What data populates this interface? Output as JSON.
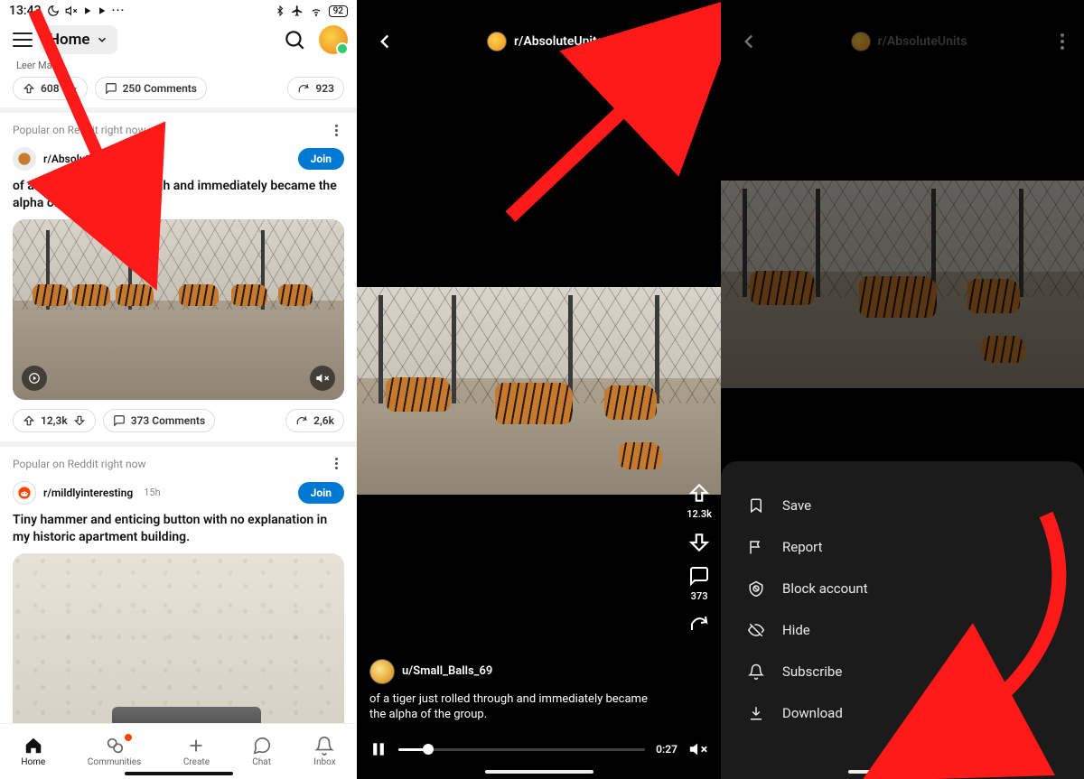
{
  "status": {
    "time": "13:43",
    "battery": "92"
  },
  "topbar": {
    "home_label": "Home"
  },
  "prev_post": {
    "leer": "Leer Más >",
    "score": "608",
    "comments": "250 Comments",
    "shares": "923"
  },
  "section_label": "Popular on Reddit right now",
  "post_tiger": {
    "subreddit": "r/AbsoluteUnits",
    "join": "Join",
    "title": "of a tiger just rolled through and immediately became the alpha of the group.",
    "score": "12,3k",
    "comments": "373 Comments",
    "shares": "2,6k"
  },
  "post_hammer": {
    "subreddit": "r/mildlyinteresting",
    "time": "15h",
    "join": "Join",
    "title": "Tiny hammer and enticing button with no explanation in my historic apartment building."
  },
  "nav": {
    "home": "Home",
    "communities": "Communities",
    "create": "Create",
    "chat": "Chat",
    "inbox": "Inbox"
  },
  "player": {
    "subreddit": "r/AbsoluteUnits",
    "user": "u/Small_Balls_69",
    "caption": "of a tiger just rolled through and immediately became the alpha of the group.",
    "score": "12.3k",
    "comments": "373",
    "time": "0:27"
  },
  "sheet": {
    "save": "Save",
    "report": "Report",
    "block": "Block account",
    "hide": "Hide",
    "subscribe": "Subscribe",
    "download": "Download"
  }
}
